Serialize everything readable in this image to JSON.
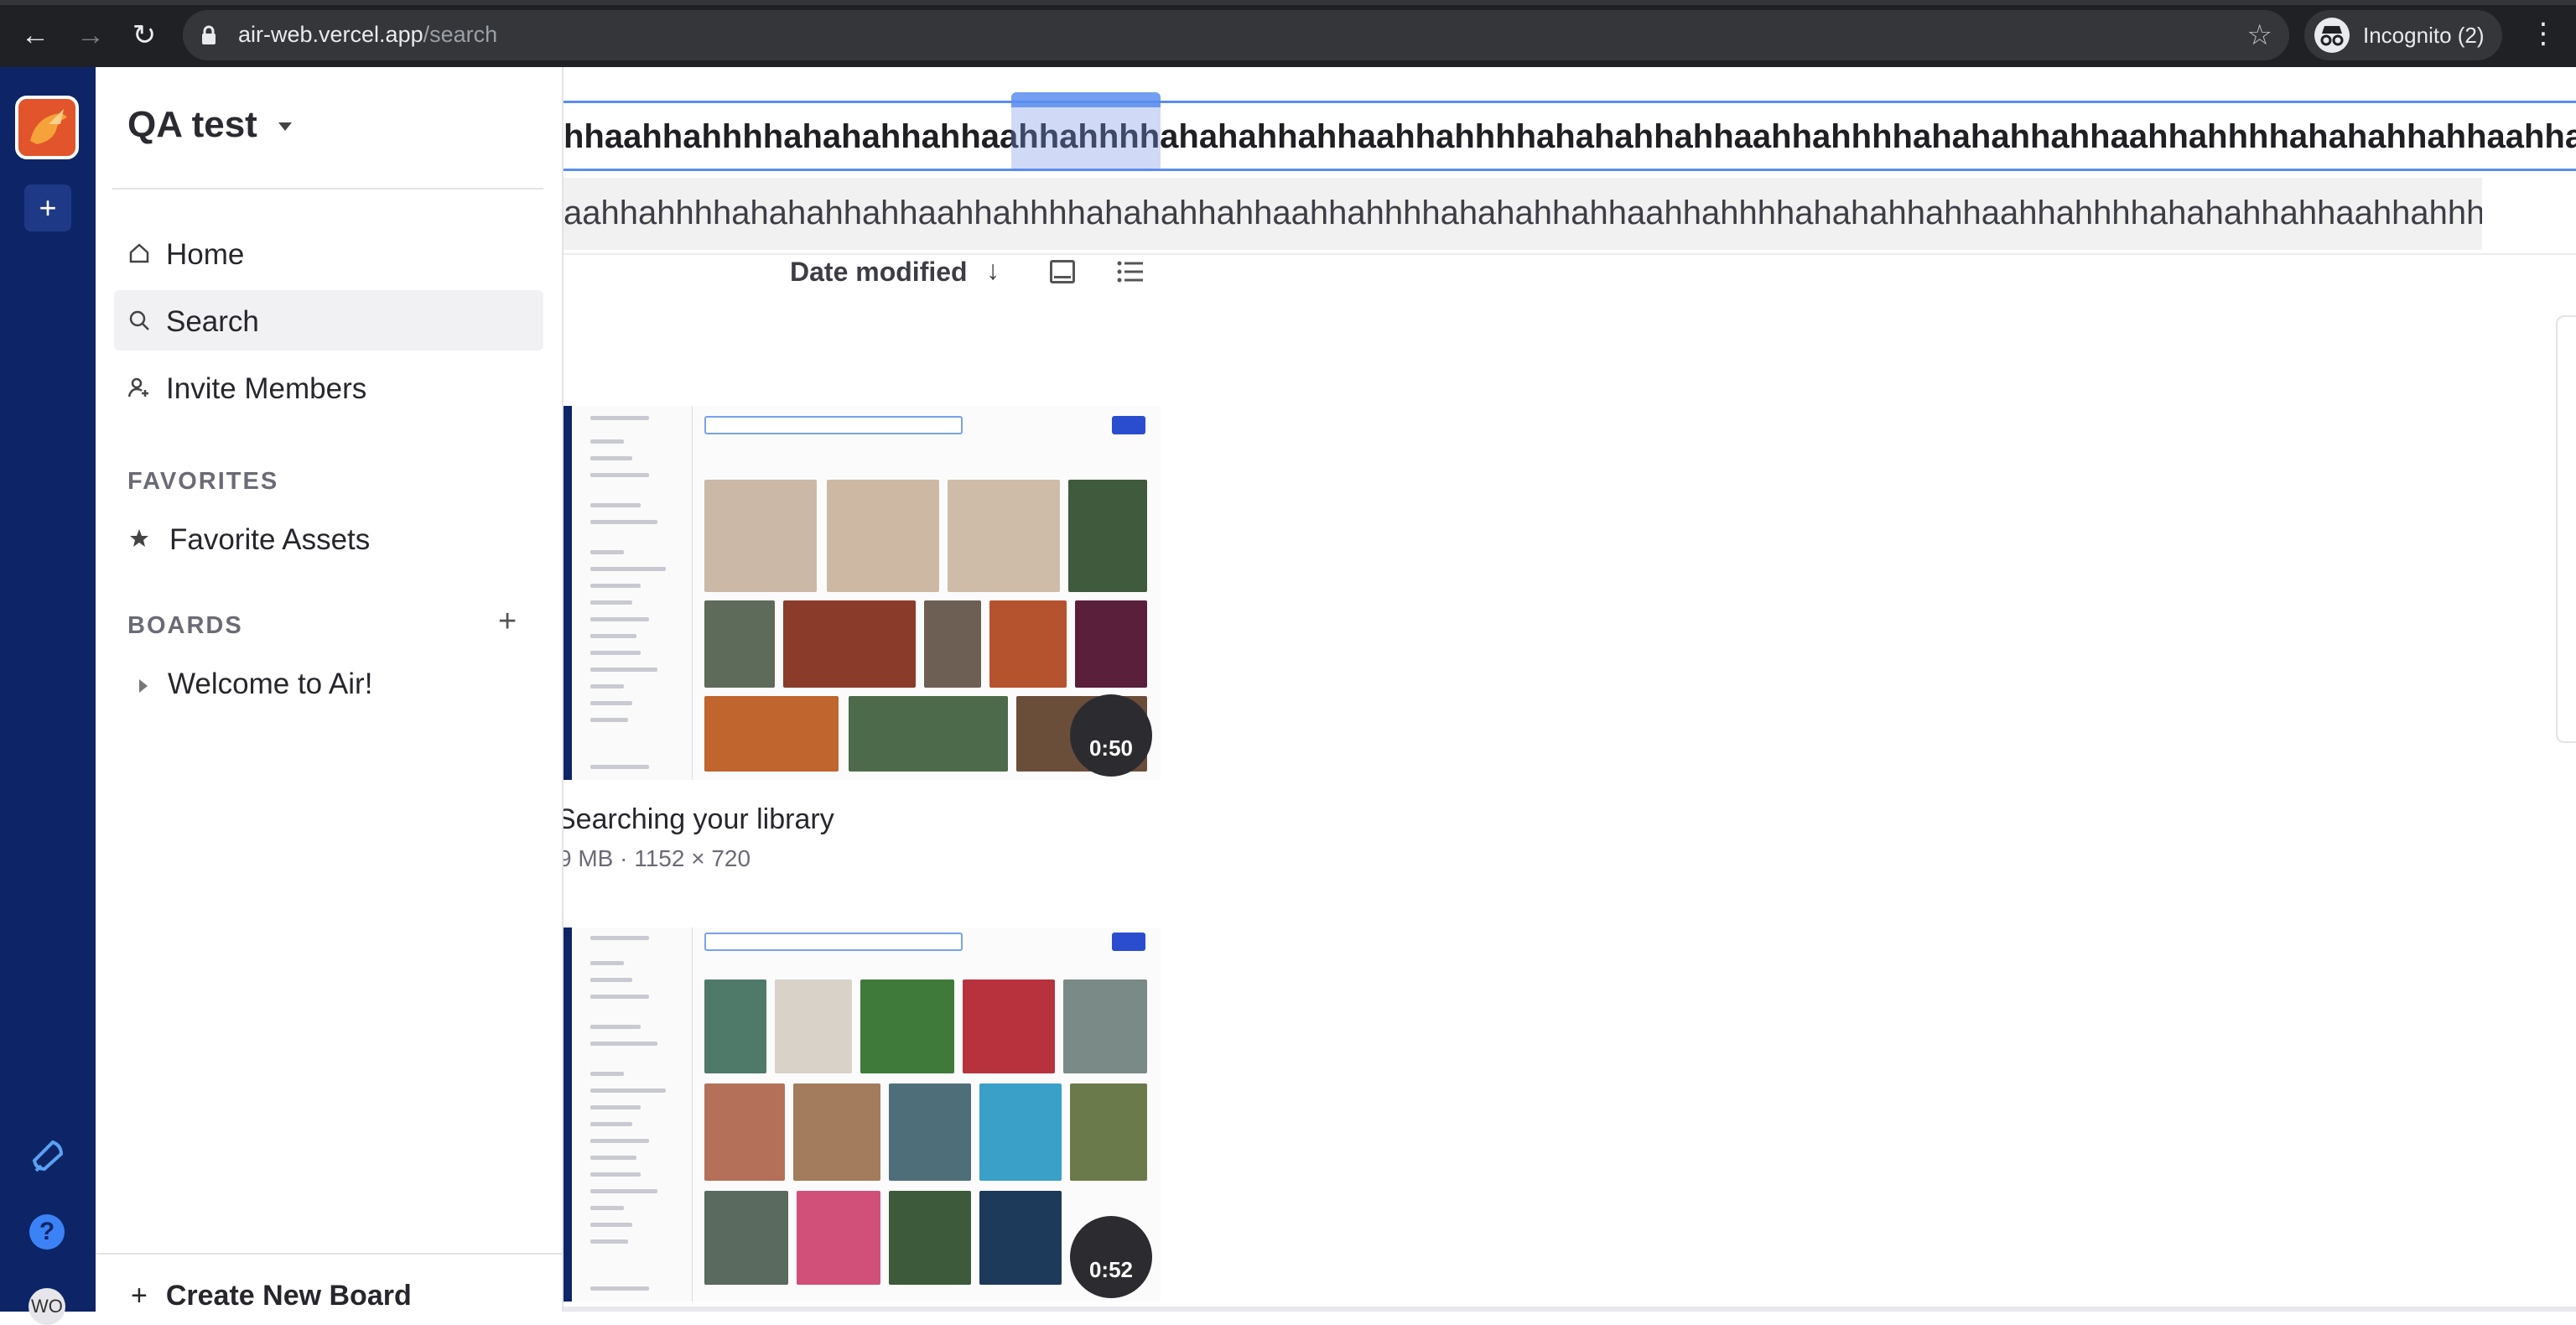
{
  "browser": {
    "url_host": "air-web.vercel.app",
    "url_path": "/search",
    "profile_label": "Incognito (2)"
  },
  "sidebar": {
    "workspace_name": "QA test",
    "nav": [
      {
        "label": "Home",
        "icon": "home-icon"
      },
      {
        "label": "Search",
        "icon": "search-icon",
        "active": true
      },
      {
        "label": "Invite Members",
        "icon": "add-user-icon"
      }
    ],
    "favorites_header": "FAVORITES",
    "favorites": [
      {
        "label": "Favorite Assets",
        "icon": "star-icon"
      }
    ],
    "boards_header": "BOARDS",
    "boards": [
      {
        "label": "Welcome to Air!"
      }
    ],
    "create_board_label": "Create New Board"
  },
  "main": {
    "search_query": "hhaahhahhhhahahahhahhaahhahhhhahahahhahhaahhahhhhahahahhahhaahhahhhhahahahhahhaahhahhhhahahahhahhaahhahhhhahahahhahhaahhahhhhahahahhahhaahhahhhh",
    "suggestion": "aahhahhhhahahahhahhaahhahhhhahahahhahhaahhahhhhahahahhahhaahhahhhhahahahhahhaahhahhhhahahahhahhaahhahhh",
    "sort_label": "Date modified",
    "sort_direction_icon": "arrow-down-icon",
    "view_icons": [
      "gallery-view-icon",
      "list-view-icon"
    ],
    "cards": [
      {
        "title": "Searching your library",
        "meta": "9 MB · 1152 × 720",
        "duration": "0:50"
      },
      {
        "title": "",
        "meta": "",
        "duration": "0:52"
      }
    ]
  },
  "colors": {
    "rail": "#0d2567",
    "accent": "#5b8def",
    "chrome": "#202124"
  }
}
